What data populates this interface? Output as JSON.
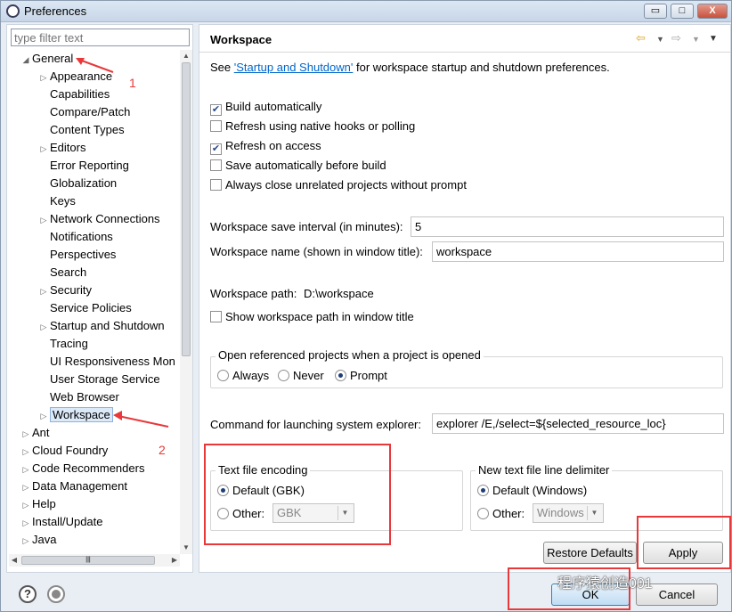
{
  "window": {
    "title": "Preferences",
    "min_label": "▭",
    "max_label": "□",
    "close_label": "X"
  },
  "left": {
    "filter_placeholder": "type filter text",
    "tree": [
      {
        "label": "General",
        "level": 0,
        "arrow": "◢"
      },
      {
        "label": "Appearance",
        "level": 1,
        "arrow": "▷"
      },
      {
        "label": "Capabilities",
        "level": 1,
        "arrow": ""
      },
      {
        "label": "Compare/Patch",
        "level": 1,
        "arrow": ""
      },
      {
        "label": "Content Types",
        "level": 1,
        "arrow": ""
      },
      {
        "label": "Editors",
        "level": 1,
        "arrow": "▷"
      },
      {
        "label": "Error Reporting",
        "level": 1,
        "arrow": ""
      },
      {
        "label": "Globalization",
        "level": 1,
        "arrow": ""
      },
      {
        "label": "Keys",
        "level": 1,
        "arrow": ""
      },
      {
        "label": "Network Connections",
        "level": 1,
        "arrow": "▷"
      },
      {
        "label": "Notifications",
        "level": 1,
        "arrow": ""
      },
      {
        "label": "Perspectives",
        "level": 1,
        "arrow": ""
      },
      {
        "label": "Search",
        "level": 1,
        "arrow": ""
      },
      {
        "label": "Security",
        "level": 1,
        "arrow": "▷"
      },
      {
        "label": "Service Policies",
        "level": 1,
        "arrow": ""
      },
      {
        "label": "Startup and Shutdown",
        "level": 1,
        "arrow": "▷"
      },
      {
        "label": "Tracing",
        "level": 1,
        "arrow": ""
      },
      {
        "label": "UI Responsiveness Mon",
        "level": 1,
        "arrow": ""
      },
      {
        "label": "User Storage Service",
        "level": 1,
        "arrow": ""
      },
      {
        "label": "Web Browser",
        "level": 1,
        "arrow": ""
      },
      {
        "label": "Workspace",
        "level": 1,
        "arrow": "▷",
        "selected": true
      },
      {
        "label": "Ant",
        "level": 0,
        "arrow": "▷"
      },
      {
        "label": "Cloud Foundry",
        "level": 0,
        "arrow": "▷"
      },
      {
        "label": "Code Recommenders",
        "level": 0,
        "arrow": "▷"
      },
      {
        "label": "Data Management",
        "level": 0,
        "arrow": "▷"
      },
      {
        "label": "Help",
        "level": 0,
        "arrow": "▷"
      },
      {
        "label": "Install/Update",
        "level": 0,
        "arrow": "▷"
      },
      {
        "label": "Java",
        "level": 0,
        "arrow": "▷"
      }
    ],
    "hscroll_thumb": "|||"
  },
  "page": {
    "title": "Workspace",
    "see_prefix": "See ",
    "see_link": "'Startup and Shutdown'",
    "see_suffix": " for workspace startup and shutdown preferences.",
    "checkboxes": [
      {
        "label": "Build automatically",
        "checked": true
      },
      {
        "label": "Refresh using native hooks or polling",
        "checked": false
      },
      {
        "label": "Refresh on access",
        "checked": true
      },
      {
        "label": "Save automatically before build",
        "checked": false
      },
      {
        "label": "Always close unrelated projects without prompt",
        "checked": false
      }
    ],
    "save_interval_label": "Workspace save interval (in minutes):",
    "save_interval_value": "5",
    "name_label": "Workspace name (shown in window title):",
    "name_value": "workspace",
    "path_label": "Workspace path:",
    "path_value": "D:\\workspace",
    "show_path_label": "Show workspace path in window title",
    "open_ref_group": "Open referenced projects when a project is opened",
    "open_ref_options": [
      "Always",
      "Never",
      "Prompt"
    ],
    "open_ref_selected": "Prompt",
    "explorer_label": "Command for launching system explorer:",
    "explorer_value": "explorer /E,/select=${selected_resource_loc}",
    "encoding_group": "Text file encoding",
    "encoding_default": "Default (GBK)",
    "encoding_other": "Other:",
    "encoding_other_value": "GBK",
    "delimiter_group": "New text file line delimiter",
    "delimiter_default": "Default (Windows)",
    "delimiter_other": "Other:",
    "delimiter_other_value": "Windows",
    "restore_defaults": "Restore Defaults",
    "apply": "Apply"
  },
  "footer": {
    "help_icon": "?",
    "ok": "OK",
    "cancel": "Cancel"
  },
  "annotations": {
    "num1": "1",
    "num2": "2",
    "color": "#e8383a"
  },
  "watermark": "程序猿创造001"
}
